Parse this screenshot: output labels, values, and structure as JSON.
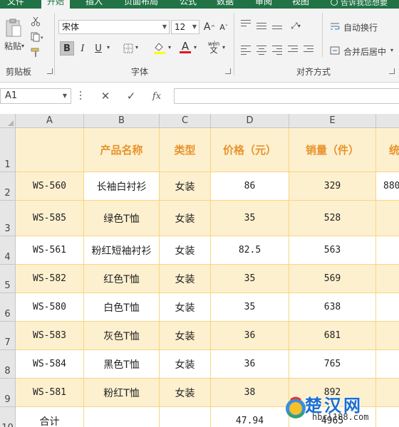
{
  "ribbon": {
    "tabs": [
      "文件",
      "开始",
      "插入",
      "页面布局",
      "公式",
      "数据",
      "审阅",
      "视图"
    ],
    "active_tab": "开始",
    "tell_me": "告诉我您想要",
    "clipboard": {
      "paste": "粘贴",
      "group": "剪贴板"
    },
    "font": {
      "name": "宋体",
      "size": "12",
      "group": "字体",
      "bold": "B",
      "italic": "I",
      "underline": "U",
      "font_color_letter": "A",
      "wen": "wén",
      "grow": "A",
      "shrink": "A"
    },
    "alignment": {
      "wrap_text": "自动换行",
      "merge_center": "合并后居中",
      "group": "对齐方式"
    }
  },
  "formula_bar": {
    "name_box": "A1",
    "cancel": "✕",
    "enter": "✓",
    "fx": "fx",
    "value": ""
  },
  "sheet": {
    "columns": [
      "A",
      "B",
      "C",
      "D",
      "E"
    ],
    "rows": [
      "1",
      "2",
      "3",
      "4",
      "5",
      "6",
      "7",
      "8",
      "9",
      "10"
    ],
    "header": [
      "",
      "产品名称",
      "类型",
      "价格（元）",
      "销量（件）",
      "统"
    ],
    "data": [
      [
        "WS-560",
        "长袖白衬衫",
        "女装",
        "86",
        "329",
        "880"
      ],
      [
        "WS-585",
        "绿色T恤",
        "女装",
        "35",
        "528",
        ""
      ],
      [
        "WS-561",
        "粉红短袖衬衫",
        "女装",
        "82.5",
        "563",
        ""
      ],
      [
        "WS-582",
        "红色T恤",
        "女装",
        "35",
        "569",
        ""
      ],
      [
        "WS-580",
        "白色T恤",
        "女装",
        "35",
        "638",
        ""
      ],
      [
        "WS-583",
        "灰色T恤",
        "女装",
        "36",
        "681",
        ""
      ],
      [
        "WS-584",
        "黑色T恤",
        "女装",
        "36",
        "765",
        ""
      ],
      [
        "WS-581",
        "粉红T恤",
        "女装",
        "38",
        "892",
        ""
      ]
    ],
    "total_row": [
      "合计",
      "",
      "",
      "47.94",
      "4965",
      ""
    ]
  },
  "watermark": {
    "name": "楚汉网",
    "url": "hbcl188.com"
  },
  "colors": {
    "ribbon_green": "#217346",
    "header_fill": "#fdf0cf",
    "header_text": "#e8932b",
    "grid_line": "#f5d77e"
  }
}
